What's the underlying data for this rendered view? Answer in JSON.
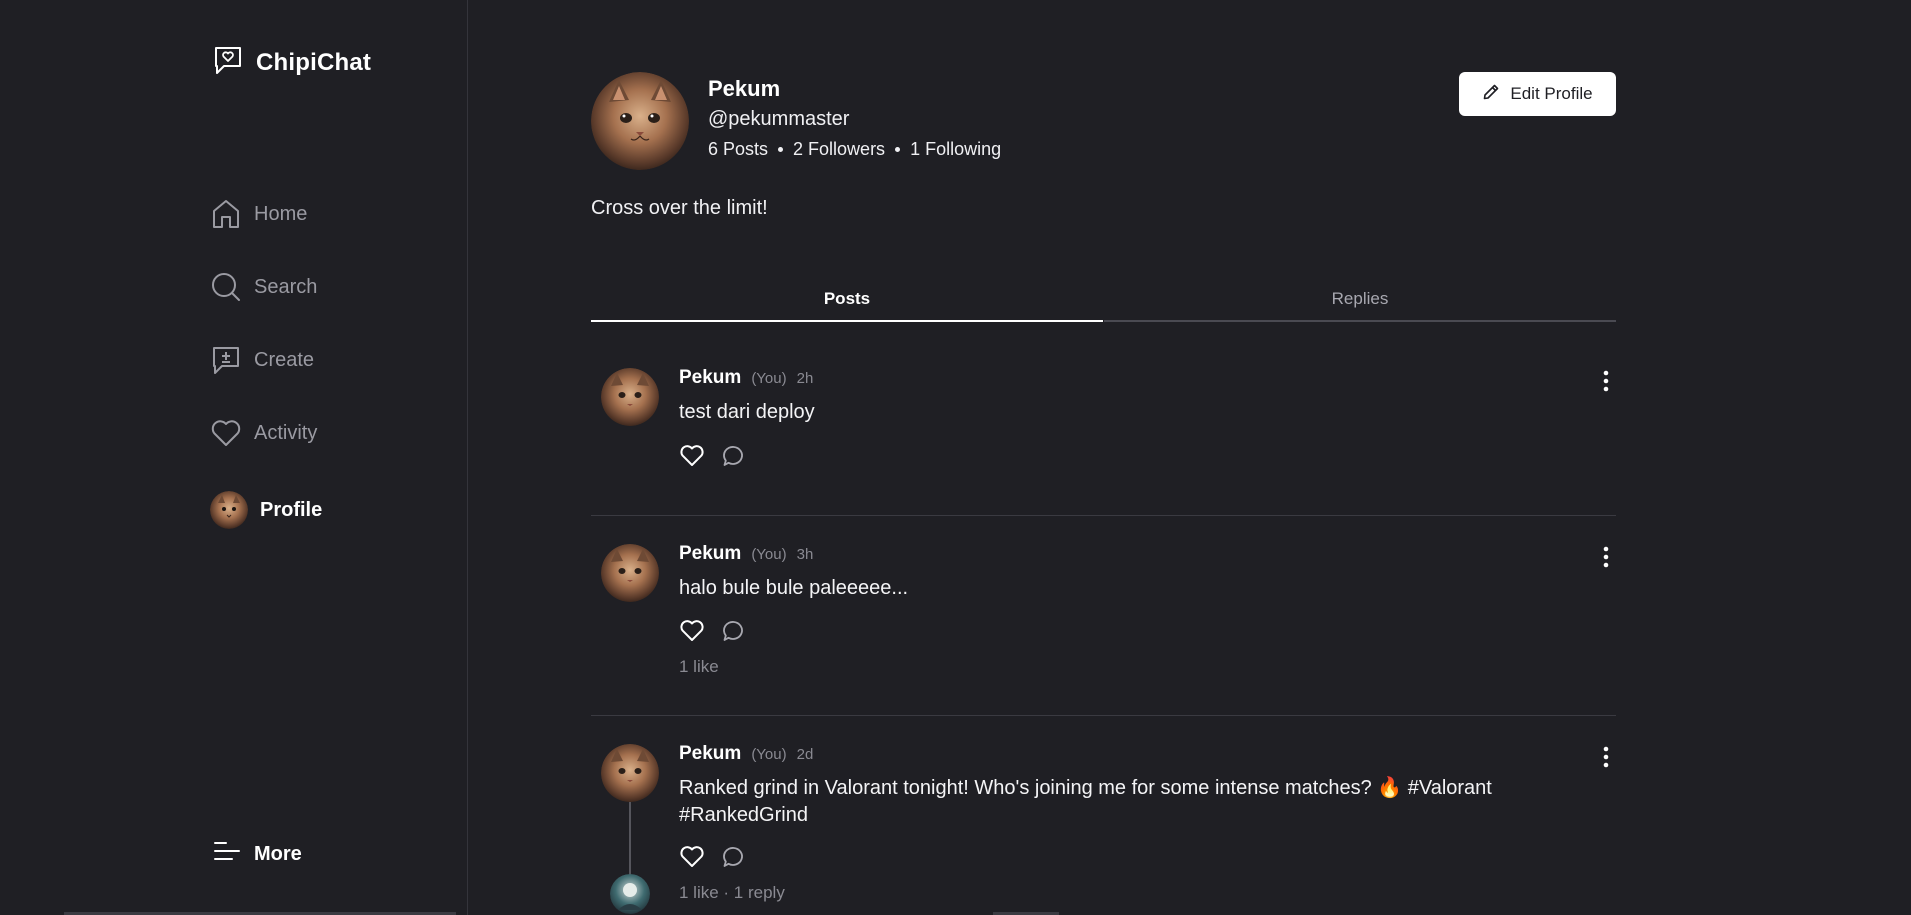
{
  "app": {
    "name": "ChipiChat"
  },
  "nav": {
    "home": "Home",
    "search": "Search",
    "create": "Create",
    "activity": "Activity",
    "profile": "Profile",
    "more": "More"
  },
  "profile": {
    "name": "Pekum",
    "handle": "@pekummaster",
    "posts": "6 Posts",
    "followers": "2 Followers",
    "following": "1 Following",
    "bio": "Cross over the limit!",
    "edit_label": "Edit Profile"
  },
  "tabs": {
    "posts": "Posts",
    "replies": "Replies"
  },
  "posts": [
    {
      "name": "Pekum",
      "you": "(You)",
      "time": "2h",
      "text": "test dari deploy",
      "meta": ""
    },
    {
      "name": "Pekum",
      "you": "(You)",
      "time": "3h",
      "text": "halo bule bule paleeeee...",
      "meta": "1 like"
    },
    {
      "name": "Pekum",
      "you": "(You)",
      "time": "2d",
      "text": "Ranked grind in Valorant tonight! Who's joining me for some intense matches? 🔥 #Valorant #RankedGrind",
      "meta": "1 like · 1 reply"
    }
  ],
  "colors": {
    "background": "#1f1f24",
    "text": "#ffffff",
    "muted": "#8a8a92",
    "button": "#ffffff"
  }
}
